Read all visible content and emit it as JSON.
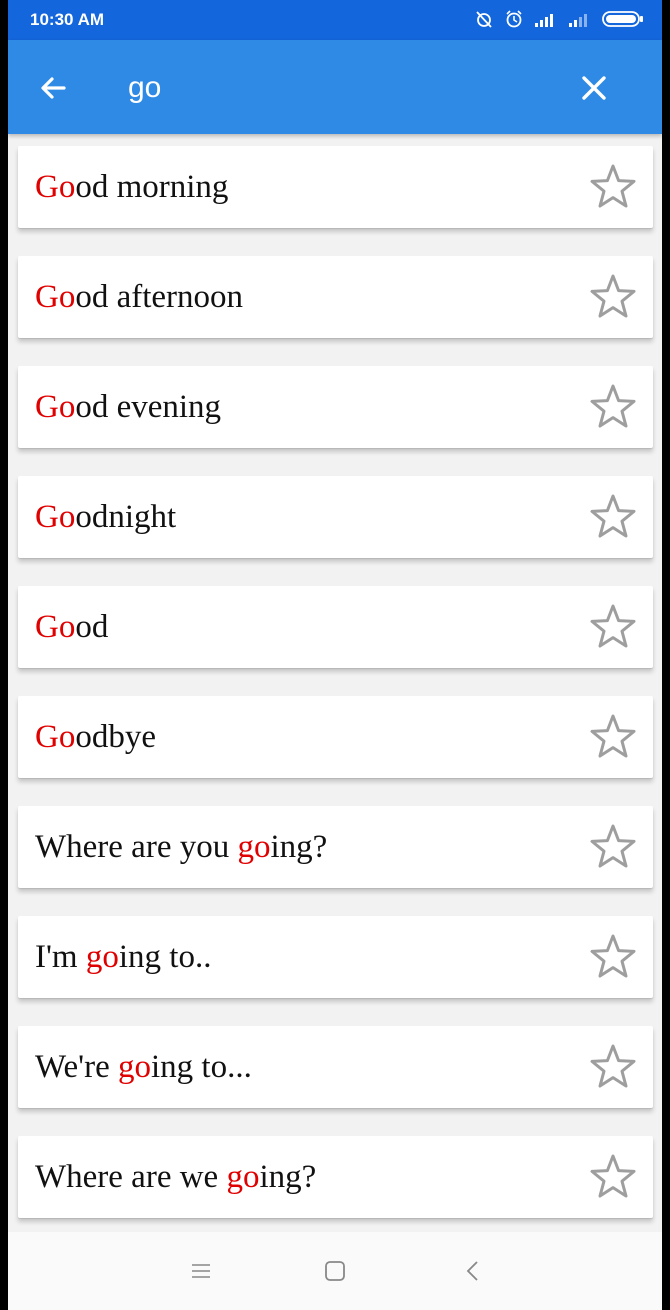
{
  "status": {
    "time": "10:30 AM"
  },
  "search": {
    "query": "go"
  },
  "results": [
    {
      "pre": "",
      "match": "Go",
      "post": "od morning"
    },
    {
      "pre": "",
      "match": "Go",
      "post": "od afternoon"
    },
    {
      "pre": "",
      "match": "Go",
      "post": "od evening"
    },
    {
      "pre": "",
      "match": "Go",
      "post": "odnight"
    },
    {
      "pre": "",
      "match": "Go",
      "post": "od"
    },
    {
      "pre": "",
      "match": "Go",
      "post": "odbye"
    },
    {
      "pre": "Where are you ",
      "match": "go",
      "post": "ing?"
    },
    {
      "pre": "I'm ",
      "match": "go",
      "post": "ing to.."
    },
    {
      "pre": "We're ",
      "match": "go",
      "post": "ing to..."
    },
    {
      "pre": "Where are we ",
      "match": "go",
      "post": "ing?"
    }
  ],
  "icons": {
    "back": "arrow-back-icon",
    "clear": "close-icon",
    "favorite": "star-outline-icon"
  },
  "colors": {
    "status_bar": "#1466dc",
    "app_bar": "#2f8ae6",
    "highlight": "#e00000",
    "star": "#9e9e9e"
  }
}
